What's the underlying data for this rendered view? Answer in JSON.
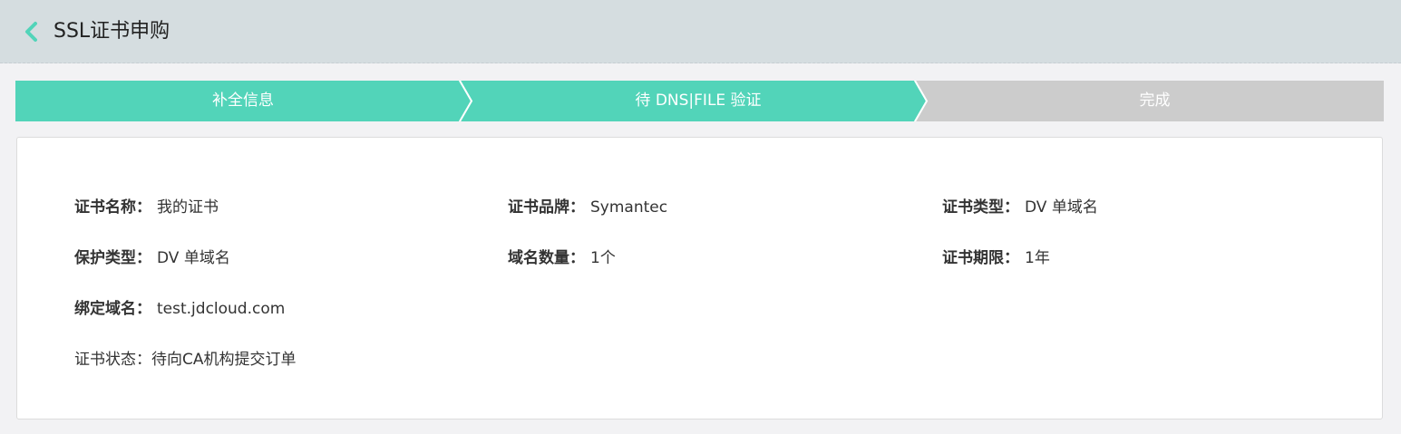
{
  "header": {
    "title": "SSL证书申购",
    "back_icon": "chevron-left-icon",
    "accent_color": "#52d4b9"
  },
  "steps": [
    {
      "label": "补全信息",
      "state": "done"
    },
    {
      "label": "待 DNS|FILE 验证",
      "state": "active"
    },
    {
      "label": "完成",
      "state": "pending"
    }
  ],
  "step_colors": {
    "done": "#52d4b9",
    "pending": "#cccccc"
  },
  "details": {
    "cert_name": {
      "label": "证书名称：",
      "value": "我的证书"
    },
    "cert_brand": {
      "label": "证书品牌：",
      "value": "Symantec"
    },
    "cert_type": {
      "label": "证书类型：",
      "value": "DV 单域名"
    },
    "protect_type": {
      "label": "保护类型：",
      "value": "DV 单域名"
    },
    "domain_count": {
      "label": "域名数量：",
      "value": "1个"
    },
    "cert_period": {
      "label": "证书期限：",
      "value": "1年"
    },
    "bound_domain": {
      "label": "绑定域名：",
      "value": "test.jdcloud.com"
    },
    "cert_status": {
      "label": "证书状态：",
      "value": "待向CA机构提交订单"
    }
  }
}
